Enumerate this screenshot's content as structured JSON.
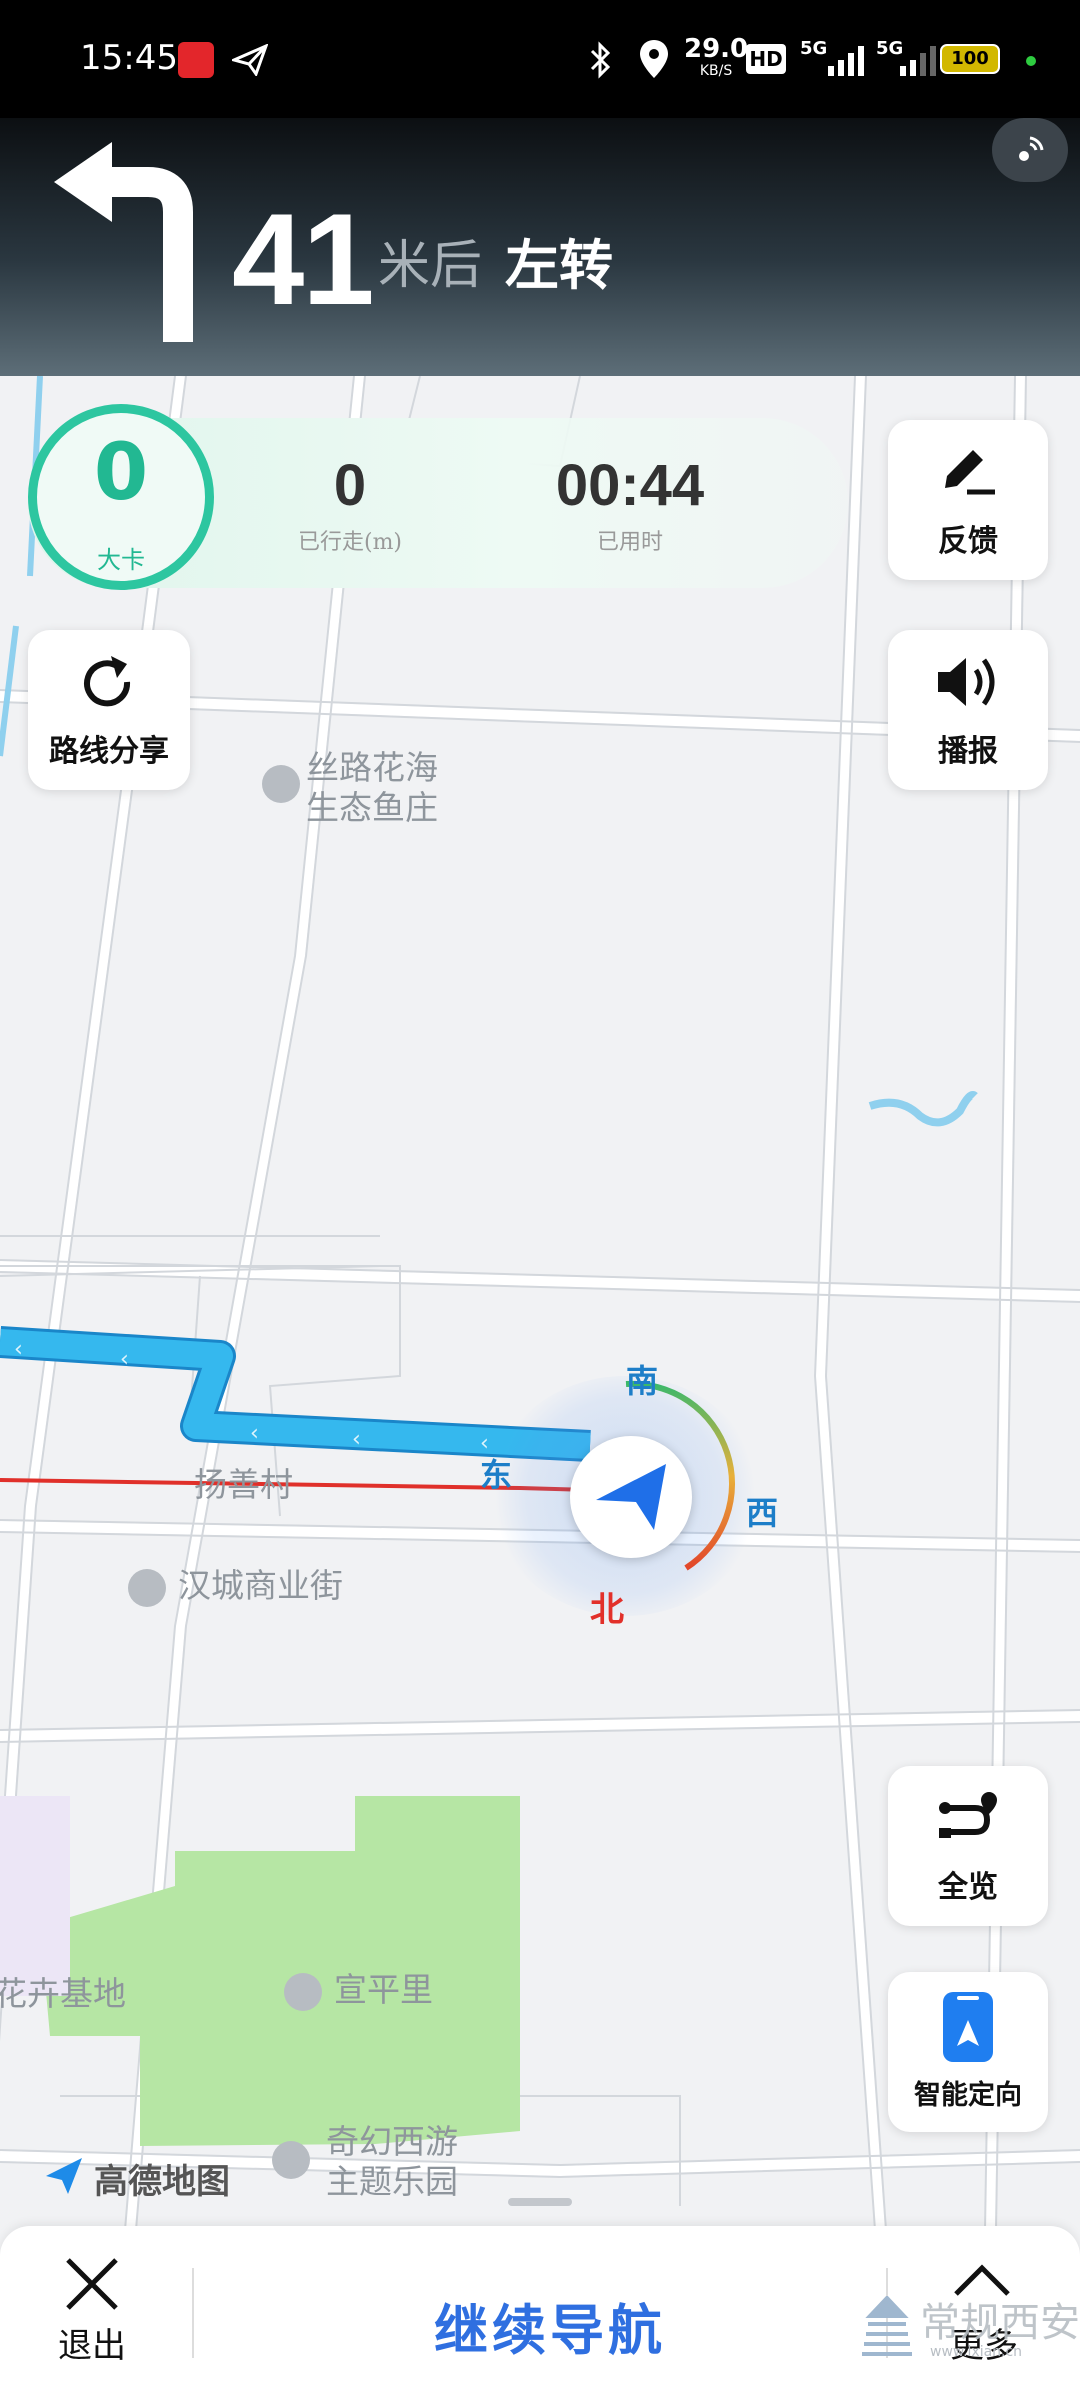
{
  "status_bar": {
    "time": "15:45",
    "net_speed": "29.0",
    "net_unit": "KB/S",
    "hd": "HD",
    "sim1": "5G",
    "sim2": "5G",
    "battery": "100",
    "icons": [
      "app-icon",
      "paper-plane-icon",
      "bluetooth-icon",
      "location-pin-icon",
      "signal-icon",
      "battery-icon"
    ]
  },
  "guidance": {
    "distance": "41",
    "unit": "米后",
    "action": "左转",
    "turn_icon": "turn-left-arrow-icon"
  },
  "stats": {
    "card_value": "0",
    "card_label": "大卡",
    "traveled_value": "0",
    "traveled_label": "已行走(m)",
    "elapsed_value": "00:44",
    "elapsed_label": "已用时",
    "accent": "#2dc6a0"
  },
  "buttons": {
    "feedback": "反馈",
    "share_route": "路线分享",
    "broadcast": "播报",
    "overview": "全览",
    "smart_orient": "智能定向"
  },
  "map": {
    "pois": [
      {
        "line1": "丝路花海",
        "line2": "生态鱼庄"
      },
      {
        "line1": "扬善村",
        "line2": ""
      },
      {
        "line1": "汉城商业街",
        "line2": ""
      },
      {
        "line1": "宣平里",
        "line2": ""
      },
      {
        "line1": "奇幻西游",
        "line2": "主题乐园"
      },
      {
        "line1": "花卉基地",
        "line2": ""
      }
    ],
    "compass": {
      "south": "南",
      "west": "西",
      "north": "北",
      "east": "东"
    },
    "logo": "高德地图",
    "route_color": "#35b8ee",
    "red_line_color": "#e0302a"
  },
  "bottom": {
    "exit": "退出",
    "continue": "继续导航",
    "more": "更多",
    "watermark": "常规西安",
    "watermark_url": "www.lxian.cn"
  }
}
